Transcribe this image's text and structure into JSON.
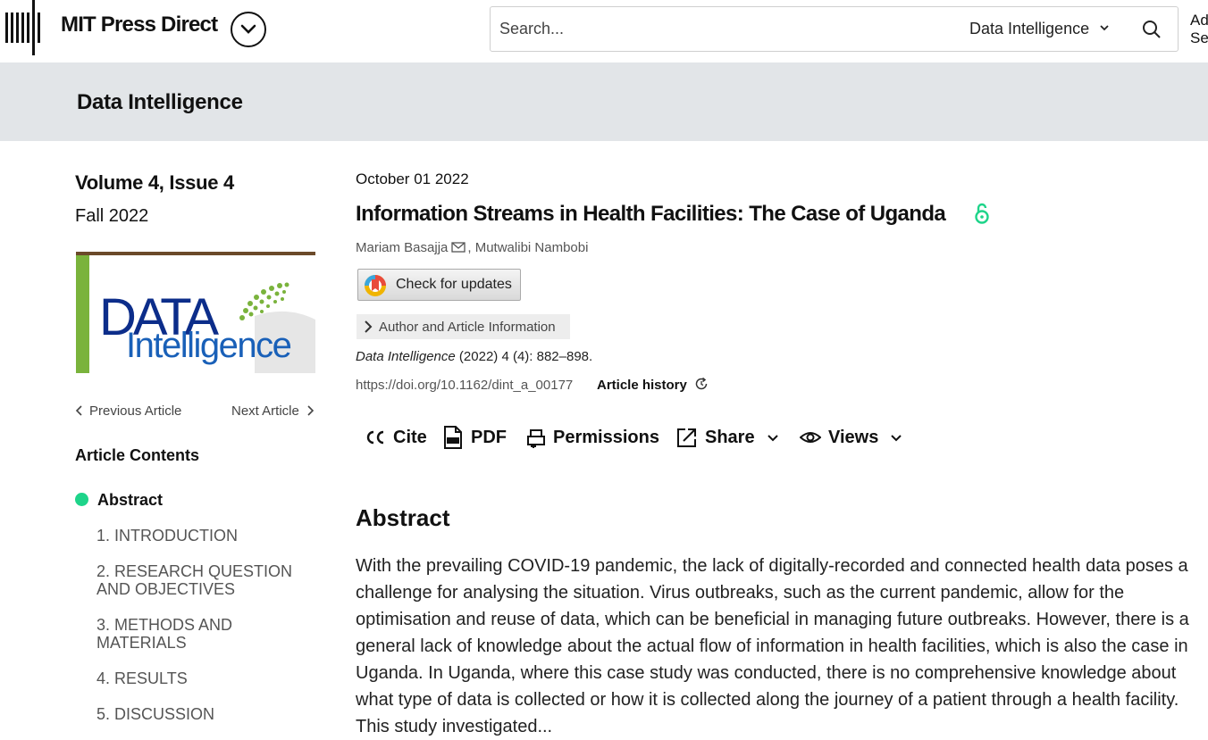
{
  "header": {
    "brand": "MIT Press Direct",
    "search_placeholder": "Search...",
    "search_scope": "Data Intelligence",
    "advanced_search": "Advanced\nSearch"
  },
  "banner": {
    "journal": "Data Intelligence"
  },
  "sidebar": {
    "volume": "Volume 4, Issue 4",
    "season": "Fall 2022",
    "prev_article": "Previous Article",
    "next_article": "Next Article",
    "contents_heading": "Article Contents",
    "toc": [
      "Abstract",
      "1. INTRODUCTION",
      "2. RESEARCH QUESTION AND OBJECTIVES",
      "3. METHODS AND MATERIALS",
      "4. RESULTS",
      "5. DISCUSSION"
    ],
    "cover_words": {
      "top": "DATA",
      "bottom": "Intelligence"
    }
  },
  "article": {
    "date": "October 01 2022",
    "title": "Information Streams in Health Facilities: The Case of Uganda",
    "author_1": "Mariam Basajja",
    "author_sep": ",",
    "author_2": "Mutwalibi Nambobi",
    "check_updates": "Check for updates",
    "author_info": "Author and Article Information",
    "journal_italic": "Data Intelligence",
    "citation_rest": " (2022) 4 (4): 882–898.",
    "doi": "https://doi.org/10.1162/dint_a_00177",
    "history": "Article history"
  },
  "toolbar": {
    "cite": "Cite",
    "pdf": "PDF",
    "permissions": "Permissions",
    "share": "Share",
    "views": "Views"
  },
  "abstract": {
    "heading": "Abstract",
    "text": "With the prevailing COVID-19 pandemic, the lack of digitally-recorded and connected health data poses a challenge for analysing the situation. Virus outbreaks, such as the current pandemic, allow for the optimisation and reuse of data, which can be beneficial in managing future outbreaks. However, there is a general lack of knowledge about the actual flow of information in health facilities, which is also the case in Uganda. In Uganda, where this case study was conducted, there is no comprehensive knowledge about what type of data is collected or how it is collected along the journey of a patient through a health facility. This study investigated..."
  },
  "colors": {
    "accent": "#1ed48a",
    "banner": "#e2e5e8"
  }
}
